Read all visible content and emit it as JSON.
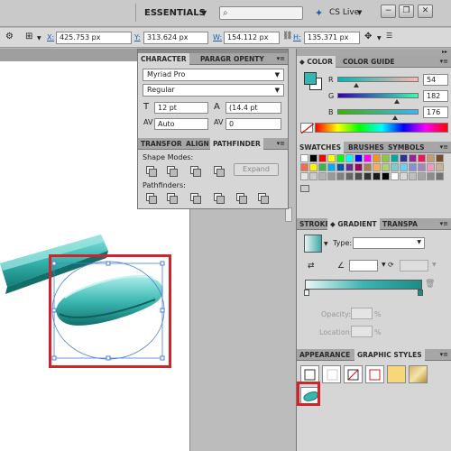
{
  "app_bar": {
    "workspace": "ESSENTIALS",
    "search_placeholder": "",
    "cs_live": "CS Live"
  },
  "control_bar": {
    "x_label": "X:",
    "x_value": "425.753 px",
    "y_label": "Y:",
    "y_value": "313.624 px",
    "w_label": "W:",
    "w_value": "154.112 px",
    "h_label": "H:",
    "h_value": "135.371 px"
  },
  "character_panel": {
    "tabs": [
      "CHARACTER",
      "PARAGR",
      "OPENTY"
    ],
    "font_family": "Myriad Pro",
    "font_style": "Regular",
    "font_size": "12 pt",
    "leading": "(14.4 pt",
    "kerning": "Auto",
    "tracking": "0"
  },
  "pathfinder_panel": {
    "tabs": [
      "TRANSFOR",
      "ALIGN",
      "PATHFINDER"
    ],
    "shape_modes_label": "Shape Modes:",
    "pathfinders_label": "Pathfinders:",
    "expand_label": "Expand"
  },
  "color_panel": {
    "tabs": [
      "COLOR",
      "COLOR GUIDE"
    ],
    "r_label": "R",
    "r_value": "54",
    "g_label": "G",
    "g_value": "182",
    "b_label": "B",
    "b_value": "176",
    "fill_color": "#36b6b0"
  },
  "swatches_panel": {
    "tabs": [
      "SWATCHES",
      "BRUSHES",
      "SYMBOLS"
    ]
  },
  "gradient_panel": {
    "tabs": [
      "STROKE",
      "GRADIENT",
      "TRANSPA"
    ],
    "type_label": "Type:",
    "opacity_label": "Opacity:",
    "location_label": "Location:",
    "percent": "%"
  },
  "graphic_styles_panel": {
    "tabs": [
      "APPEARANCE",
      "GRAPHIC STYLES"
    ]
  },
  "colors": {
    "highlight": "#d3232a",
    "teal": "#36b6b0"
  }
}
